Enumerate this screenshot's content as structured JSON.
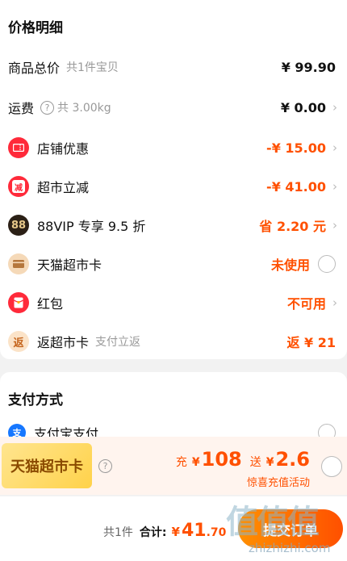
{
  "price_detail": {
    "title": "价格明细",
    "rows": [
      {
        "label": "商品总价",
        "sub": "共1件宝贝",
        "value": "¥ 99.90"
      },
      {
        "label": "运费",
        "sub": "共 3.00kg",
        "value": "¥ 0.00"
      },
      {
        "label": "店铺优惠",
        "value": "-¥ 15.00"
      },
      {
        "label": "超市立减",
        "value": "-¥ 41.00"
      },
      {
        "label": "88VIP 专享 9.5 折",
        "value": "省 2.20 元"
      },
      {
        "label": "天猫超市卡",
        "value": "未使用"
      },
      {
        "label": "红包",
        "value": "不可用"
      },
      {
        "label": "返超市卡",
        "sub": "支付立返",
        "value": "返 ¥ 21"
      }
    ],
    "icons": {
      "reduce_text": "减",
      "vip_text": "88",
      "return_text": "返"
    }
  },
  "payment": {
    "title": "支付方式",
    "alipay_label": "支付宝支付",
    "alipay_icon_text": "支"
  },
  "promo": {
    "tag": "天猫超市卡",
    "charge_label": "充",
    "charge_amount": "108",
    "gift_label": "送",
    "gift_amount": "2.6",
    "currency": "¥",
    "subtitle": "惊喜充值活动"
  },
  "footer": {
    "count": "共1件",
    "total_label": "合计:",
    "total_currency": "¥",
    "total_int": "41",
    "total_dec": ".70",
    "submit": "提交订单"
  },
  "watermark": {
    "text": "值值值",
    "url": "zhizhizhi.com"
  },
  "colors": {
    "accent": "#ff5000",
    "shop_icon": "#ff2a3a",
    "vip_icon": "#2b2016",
    "card_icon": "#f5d9b8"
  }
}
